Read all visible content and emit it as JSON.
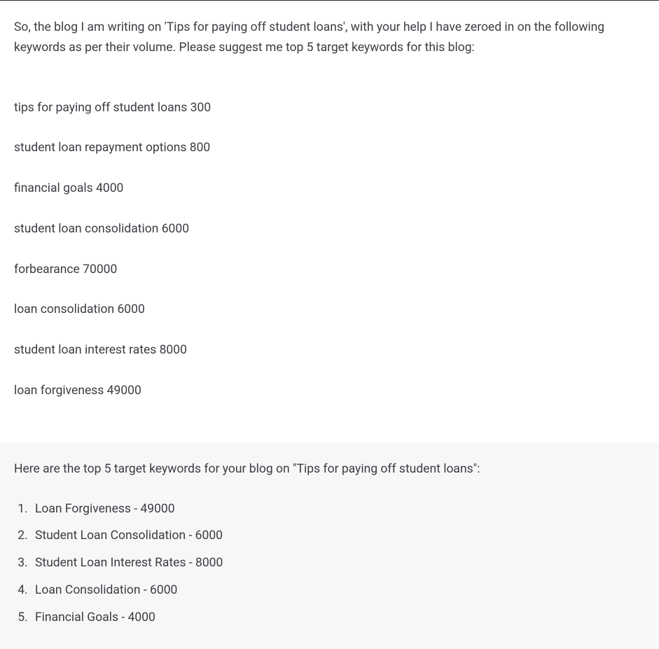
{
  "user_message": {
    "intro": "So, the blog I am writing on 'Tips for paying off student loans', with your help I have zeroed in on the following keywords as per their volume. Please suggest me top 5 target keywords for this blog:",
    "keywords": [
      "tips for paying off student loans 300",
      "student loan repayment options    800",
      "financial goals 4000",
      "student loan consolidation 6000",
      "forbearance 70000",
      "loan consolidation  6000",
      "student loan interest rates  8000",
      "loan forgiveness  49000"
    ]
  },
  "assistant_message": {
    "intro": "Here are the top 5 target keywords for your blog on \"Tips for paying off student loans\":",
    "top_keywords": [
      "Loan Forgiveness - 49000",
      "Student Loan Consolidation - 6000",
      "Student Loan Interest Rates - 8000",
      "Loan Consolidation - 6000",
      "Financial Goals - 4000"
    ]
  }
}
